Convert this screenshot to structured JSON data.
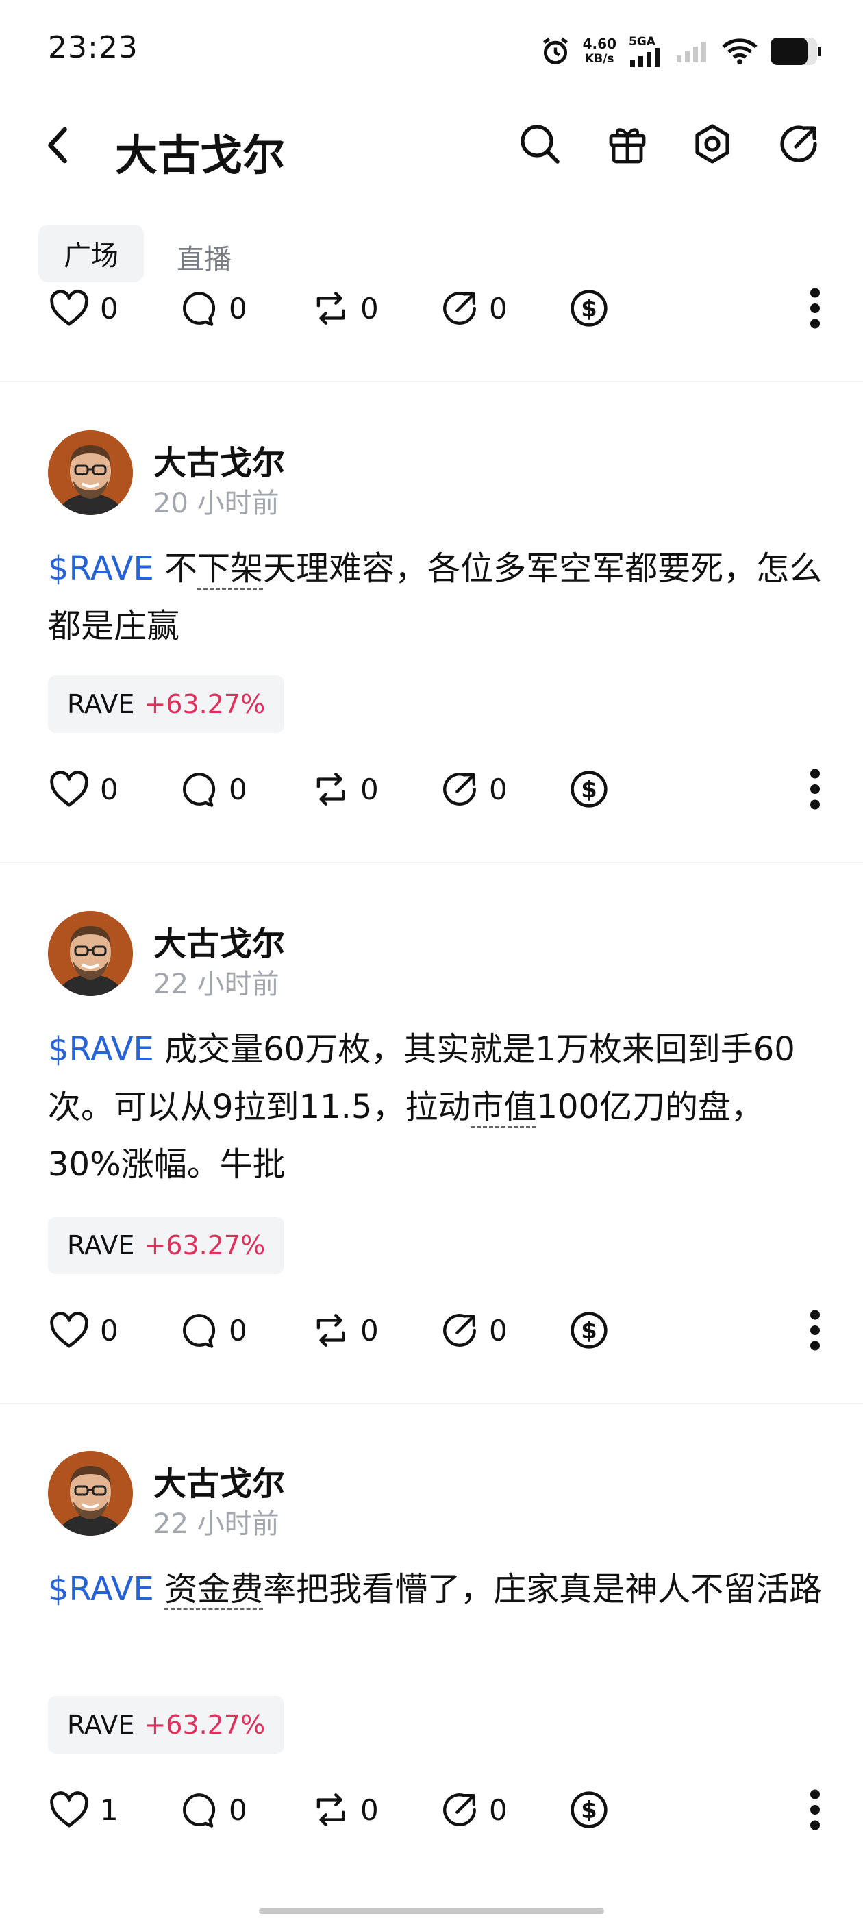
{
  "status": {
    "time": "23:23",
    "speed_value": "4.60",
    "speed_unit": "KB/s",
    "network": "5GA"
  },
  "header": {
    "title": "大古戈尔"
  },
  "tabs": [
    {
      "label": "广场",
      "active": true
    },
    {
      "label": "直播",
      "active": false
    }
  ],
  "top_actions": {
    "like": "0",
    "comment": "0",
    "repost": "0",
    "share": "0"
  },
  "posts": [
    {
      "author": "大古戈尔",
      "time": "20 小时前",
      "cashtag": "$RAVE",
      "text_a": "不",
      "text_dotted": "下架",
      "text_b": "天理难容，各位多军空军都要死，怎么都是庄赢",
      "tag_symbol": "RAVE",
      "tag_change": "+63.27%",
      "likes": "0",
      "comments": "0",
      "reposts": "0",
      "shares": "0"
    },
    {
      "author": "大古戈尔",
      "time": "22 小时前",
      "cashtag": "$RAVE",
      "text_a": "成交量60万枚，其实就是1万枚来回到手60次。可以从9拉到11.5，拉动",
      "text_dotted": "市值",
      "text_b": "100亿刀的盘，30%涨幅。牛批",
      "tag_symbol": "RAVE",
      "tag_change": "+63.27%",
      "likes": "0",
      "comments": "0",
      "reposts": "0",
      "shares": "0"
    },
    {
      "author": "大古戈尔",
      "time": "22 小时前",
      "cashtag": "$RAVE",
      "text_a": "",
      "text_dotted": "资金费",
      "text_b": "率把我看懵了，庄家真是神人不留活路",
      "tag_symbol": "RAVE",
      "tag_change": "+63.27%",
      "likes": "1",
      "comments": "0",
      "reposts": "0",
      "shares": "0"
    }
  ],
  "colors": {
    "accent": "#2563d6",
    "positive": "#e0305b"
  }
}
